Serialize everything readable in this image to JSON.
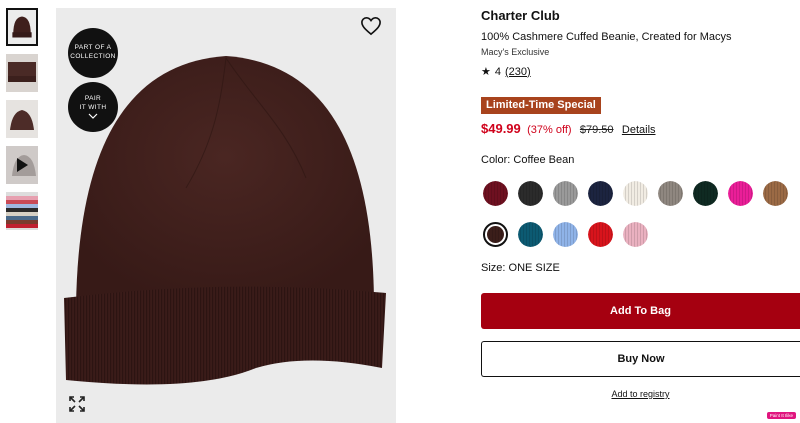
{
  "product": {
    "brand": "Charter Club",
    "title": "100% Cashmere Cuffed Beanie, Created for Macys",
    "exclusive": "Macy's Exclusive",
    "rating": "4",
    "review_count": "(230)",
    "special_badge": "Limited-Time Special",
    "sale_price": "$49.99",
    "discount": "(37% off)",
    "original_price": "$79.50",
    "details_link": "Details",
    "color_label": "Color: Coffee Bean",
    "size_label": "Size: ONE SIZE"
  },
  "image_badges": {
    "collection": [
      "PART OF A",
      "COLLECTION"
    ],
    "pair_with": [
      "PAIR",
      "IT WITH"
    ]
  },
  "thumbnails": [
    "main-view",
    "folded-view",
    "cuff-view",
    "video",
    "color-stack"
  ],
  "swatches": [
    {
      "name": "burgundy",
      "color": "#6e1020"
    },
    {
      "name": "charcoal",
      "color": "#2b2b2b"
    },
    {
      "name": "heather-grey",
      "color": "#9a9a9a"
    },
    {
      "name": "navy",
      "color": "#1c2440"
    },
    {
      "name": "ivory",
      "color": "#f1ece3"
    },
    {
      "name": "oatmeal",
      "color": "#8f8780"
    },
    {
      "name": "forest",
      "color": "#0f2a22"
    },
    {
      "name": "hot-pink",
      "color": "#ea1e98"
    },
    {
      "name": "camel",
      "color": "#9b6a45"
    },
    {
      "name": "coffee-bean",
      "color": "#3b1e1a",
      "selected": true
    },
    {
      "name": "teal",
      "color": "#0c5a72"
    },
    {
      "name": "light-blue",
      "color": "#8fb3e8"
    },
    {
      "name": "red",
      "color": "#d8141c"
    },
    {
      "name": "blush-pink",
      "color": "#eab1c0"
    }
  ],
  "actions": {
    "add_to_bag": "Add To Bag",
    "buy_now": "Buy Now",
    "registry": "Add to registry"
  },
  "extension_badge": "Paint It Ilike",
  "colors": {
    "hat": "#3f1f1c",
    "sale_red": "#d0021b",
    "add_button": "#a50010",
    "special_badge": "#a8431d"
  }
}
